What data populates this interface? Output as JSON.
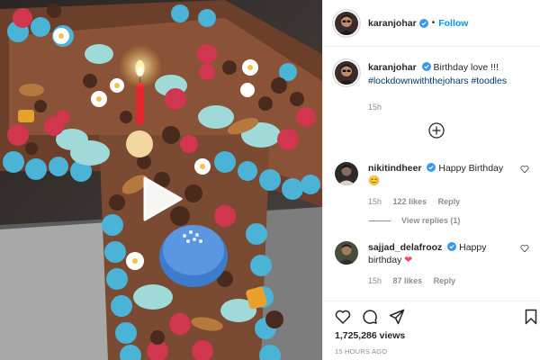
{
  "colors": {
    "accent": "#0095f6",
    "verified": "#3897f0",
    "hashtag": "#00376b",
    "muted": "#8e8e8e",
    "like_red": "#ed4956"
  },
  "video": {
    "play_icon": "play-icon",
    "description": "cake video thumbnail"
  },
  "header": {
    "username": "karanjohar",
    "separator": "•",
    "follow_label": "Follow"
  },
  "caption": {
    "username": "karanjohar",
    "text": "Birthday love !!!",
    "hashtags": [
      "#lockdownwiththejohars",
      "#toodles"
    ],
    "time": "15h"
  },
  "load_more_icon": "plus-circle-icon",
  "comments": [
    {
      "username": "nikitindheer",
      "text": "Happy Birthday",
      "emoji": "😊",
      "time": "15h",
      "likes": "122 likes",
      "reply_label": "Reply",
      "view_replies": "View replies (1)"
    },
    {
      "username": "sajjad_delafrooz",
      "text": "Happy",
      "text2": "birthday",
      "emoji": "❤",
      "time": "15h",
      "likes": "87 likes",
      "reply_label": "Reply"
    }
  ],
  "actions": [
    "heart-icon",
    "comment-icon",
    "share-icon",
    "bookmark-icon"
  ],
  "views": "1,725,286 views",
  "posted": "15 HOURS AGO"
}
